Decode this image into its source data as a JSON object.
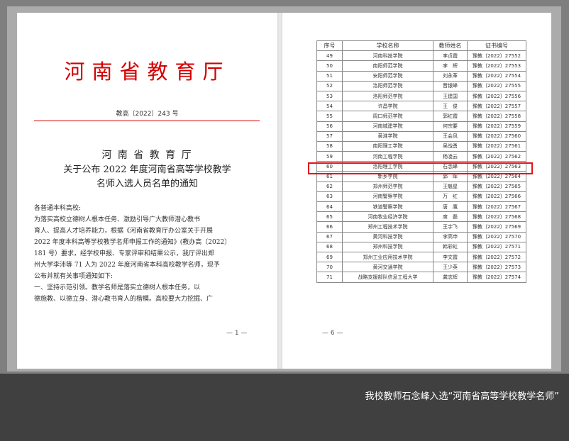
{
  "left_page": {
    "title": "河南省教育厅",
    "doc_number": "教高〔2022〕243 号",
    "heading_lines": [
      "河 南 省 教 育 厅",
      "关于公布 2022 年度河南省高等学校教学",
      "名师入选人员名单的通知"
    ],
    "body_lines": [
      "各普通本科高校:",
      "    为落实高校立德树人根本任务、激励引导广大教师潜心教书",
      "育人、提高人才培养能力，根据《河南省教育厅办公室关于开展",
      "2022 年度本科高等学校教学名师申报工作的通知》(教办高〔2022〕",
      "181 号）要求，经学校申报、专家评审和结果公示，我厅评出郑",
      "州大学李沛等 71 人为 2022 年度河南省本科高校教学名师，现予",
      "公布并就有关事项通知如下:",
      "    一、坚持示范引领。教学名师是落实立德树人根本任务，以",
      "德施教、以德立身、潜心教书育人的楷模。高校要大力挖掘、广"
    ],
    "page_number": "— 1 —"
  },
  "right_page": {
    "table_headers": [
      "序号",
      "学校名称",
      "教师姓名",
      "证书编号"
    ],
    "rows": [
      [
        "49",
        "河南科技学院",
        "李贞霞",
        "豫教〔2022〕27552"
      ],
      [
        "50",
        "南阳师范学院",
        "李　辉",
        "豫教〔2022〕27553"
      ],
      [
        "51",
        "安阳师范学院",
        "刘永革",
        "豫教〔2022〕27554"
      ],
      [
        "52",
        "洛阳师范学院",
        "晋银峰",
        "豫教〔2022〕27555"
      ],
      [
        "53",
        "洛阳师范学院",
        "王建国",
        "豫教〔2022〕27556"
      ],
      [
        "54",
        "许昌学院",
        "王　俊",
        "豫教〔2022〕27557"
      ],
      [
        "55",
        "周口师范学院",
        "郭红霞",
        "豫教〔2022〕27558"
      ],
      [
        "56",
        "河南城建学院",
        "何宗要",
        "豫教〔2022〕27559"
      ],
      [
        "57",
        "黄淮学院",
        "王会风",
        "豫教〔2022〕27560"
      ],
      [
        "58",
        "南阳理工学院",
        "吴战勇",
        "豫教〔2022〕27561"
      ],
      [
        "59",
        "河南工程学院",
        "杨凌云",
        "豫教〔2022〕27562"
      ],
      [
        "60",
        "洛阳理工学院",
        "石念峰",
        "豫教〔2022〕27563"
      ],
      [
        "61",
        "新乡学院",
        "郭　晖",
        "豫教〔2022〕27564"
      ],
      [
        "62",
        "郑州师范学院",
        "王魁星",
        "豫教〔2022〕27565"
      ],
      [
        "63",
        "河南警察学院",
        "万　红",
        "豫教〔2022〕27566"
      ],
      [
        "64",
        "铁道警察学院",
        "唐　鹰",
        "豫教〔2022〕27567"
      ],
      [
        "65",
        "河南牧业经济学院",
        "席　磊",
        "豫教〔2022〕27568"
      ],
      [
        "66",
        "郑州工程技术学院",
        "王宇飞",
        "豫教〔2022〕27569"
      ],
      [
        "67",
        "黄河科技学院",
        "李高申",
        "豫教〔2022〕27570"
      ],
      [
        "68",
        "郑州科技学院",
        "韩彩虹",
        "豫教〔2022〕27571"
      ],
      [
        "69",
        "郑州工业应用技术学院",
        "李文霞",
        "豫教〔2022〕27572"
      ],
      [
        "70",
        "黄河交通学院",
        "王少英",
        "豫教〔2022〕27573"
      ],
      [
        "71",
        "战略支援部队信息工程大学",
        "龚志辉",
        "豫教〔2022〕27574"
      ]
    ],
    "page_number": "— 6 —"
  },
  "caption": "我校教师石念峰入选“河南省高等学校教学名师”",
  "colors": {
    "title_red": "#d40000",
    "highlight_red": "#e4141b",
    "banner": "#404040"
  }
}
